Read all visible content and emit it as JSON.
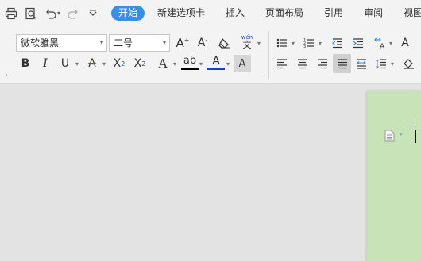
{
  "tabs": [
    {
      "label": "开始",
      "active": true
    },
    {
      "label": "新建选项卡"
    },
    {
      "label": "插入"
    },
    {
      "label": "页面布局"
    },
    {
      "label": "引用"
    },
    {
      "label": "审阅"
    },
    {
      "label": "视图"
    }
  ],
  "font": {
    "name": "微软雅黑",
    "size": "二号"
  },
  "icons": {
    "bold": "B",
    "italic": "I",
    "underline": "U",
    "strikethrough": "A",
    "superscript_base": "X",
    "superscript_sup": "2",
    "subscript_base": "X",
    "subscript_sub": "2",
    "text_effect": "A",
    "highlight": "ab",
    "font_color": "A",
    "char_shading": "A",
    "grow_font": "A",
    "grow_mark": "+",
    "shrink_font": "A",
    "shrink_mark": "-",
    "pinyin_top": "wén",
    "pinyin_char": "文",
    "sort_char": "A"
  },
  "colors": {
    "accent": "#3a8ee6",
    "font_color_underline": "#1a3fcf",
    "highlight_underline": "#000000",
    "strike_red": "#d22b2b",
    "page_bg": "#c8e3b8"
  }
}
